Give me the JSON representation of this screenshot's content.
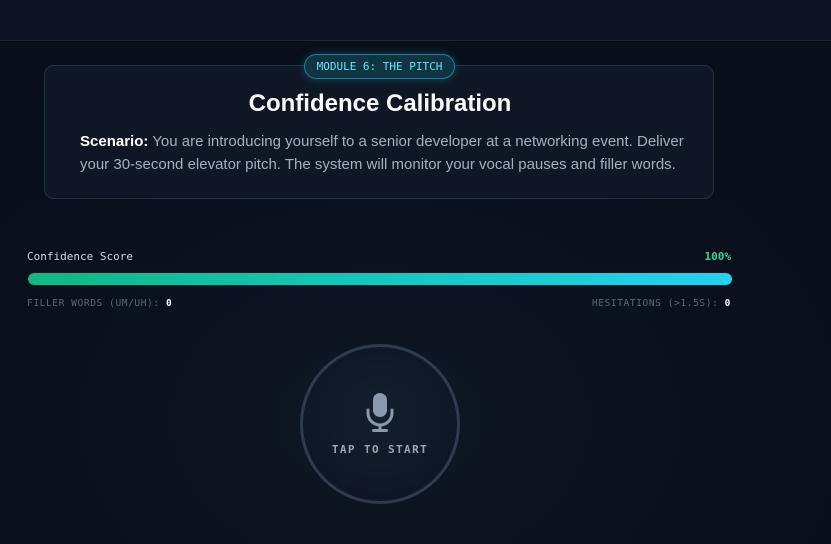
{
  "module": {
    "badge": "MODULE 6: THE PITCH"
  },
  "card": {
    "title": "Confidence Calibration",
    "scenario_label": "Scenario:",
    "scenario_text": "You are introducing yourself to a senior developer at a networking event. Deliver your 30-second elevator pitch. The system will monitor your vocal pauses and filler words."
  },
  "score": {
    "label": "Confidence Score",
    "value_text": "100%",
    "fraction": 1.0
  },
  "stats": {
    "filler_label": "FILLER WORDS (UM/UH):",
    "filler_value": "0",
    "hesitation_label": "HESITATIONS (>1.5S):",
    "hesitation_value": "0"
  },
  "mic": {
    "label": "TAP TO START",
    "icon": "microphone-icon"
  },
  "colors": {
    "accent_cyan": "#22d3ee",
    "accent_green": "#10b981",
    "background": "#0b1220"
  }
}
